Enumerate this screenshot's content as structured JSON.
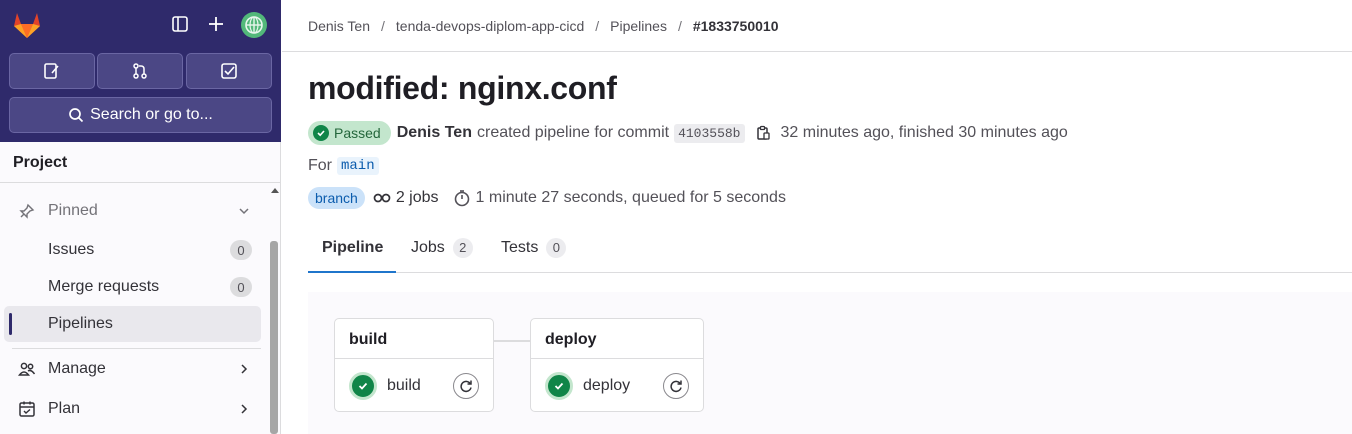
{
  "sidebar": {
    "search_label": "Search or go to...",
    "context_title": "Project",
    "pinned_label": "Pinned",
    "items": [
      {
        "label": "Issues",
        "count": "0"
      },
      {
        "label": "Merge requests",
        "count": "0"
      },
      {
        "label": "Pipelines"
      }
    ],
    "sections": [
      {
        "label": "Manage"
      },
      {
        "label": "Plan"
      }
    ]
  },
  "breadcrumb": {
    "items": [
      "Denis Ten",
      "tenda-devops-diplom-app-cicd",
      "Pipelines",
      "#1833750010"
    ]
  },
  "pipeline": {
    "title": "modified: nginx.conf",
    "status": "Passed",
    "author": "Denis Ten",
    "created_text": "created pipeline for commit",
    "commit_sha": "4103558b",
    "time_text": "32 minutes ago, finished 30 minutes ago",
    "for_label": "For",
    "ref": "main",
    "ref_type": "branch",
    "jobs_text": "2 jobs",
    "duration_text": "1 minute 27 seconds, queued for 5 seconds"
  },
  "tabs": [
    {
      "label": "Pipeline"
    },
    {
      "label": "Jobs",
      "count": "2"
    },
    {
      "label": "Tests",
      "count": "0"
    }
  ],
  "stages": [
    {
      "name": "build",
      "job": "build"
    },
    {
      "name": "deploy",
      "job": "deploy"
    }
  ],
  "colors": {
    "sidebar_top": "#2f2a6b",
    "success": "#108548",
    "link": "#1f75cb"
  }
}
